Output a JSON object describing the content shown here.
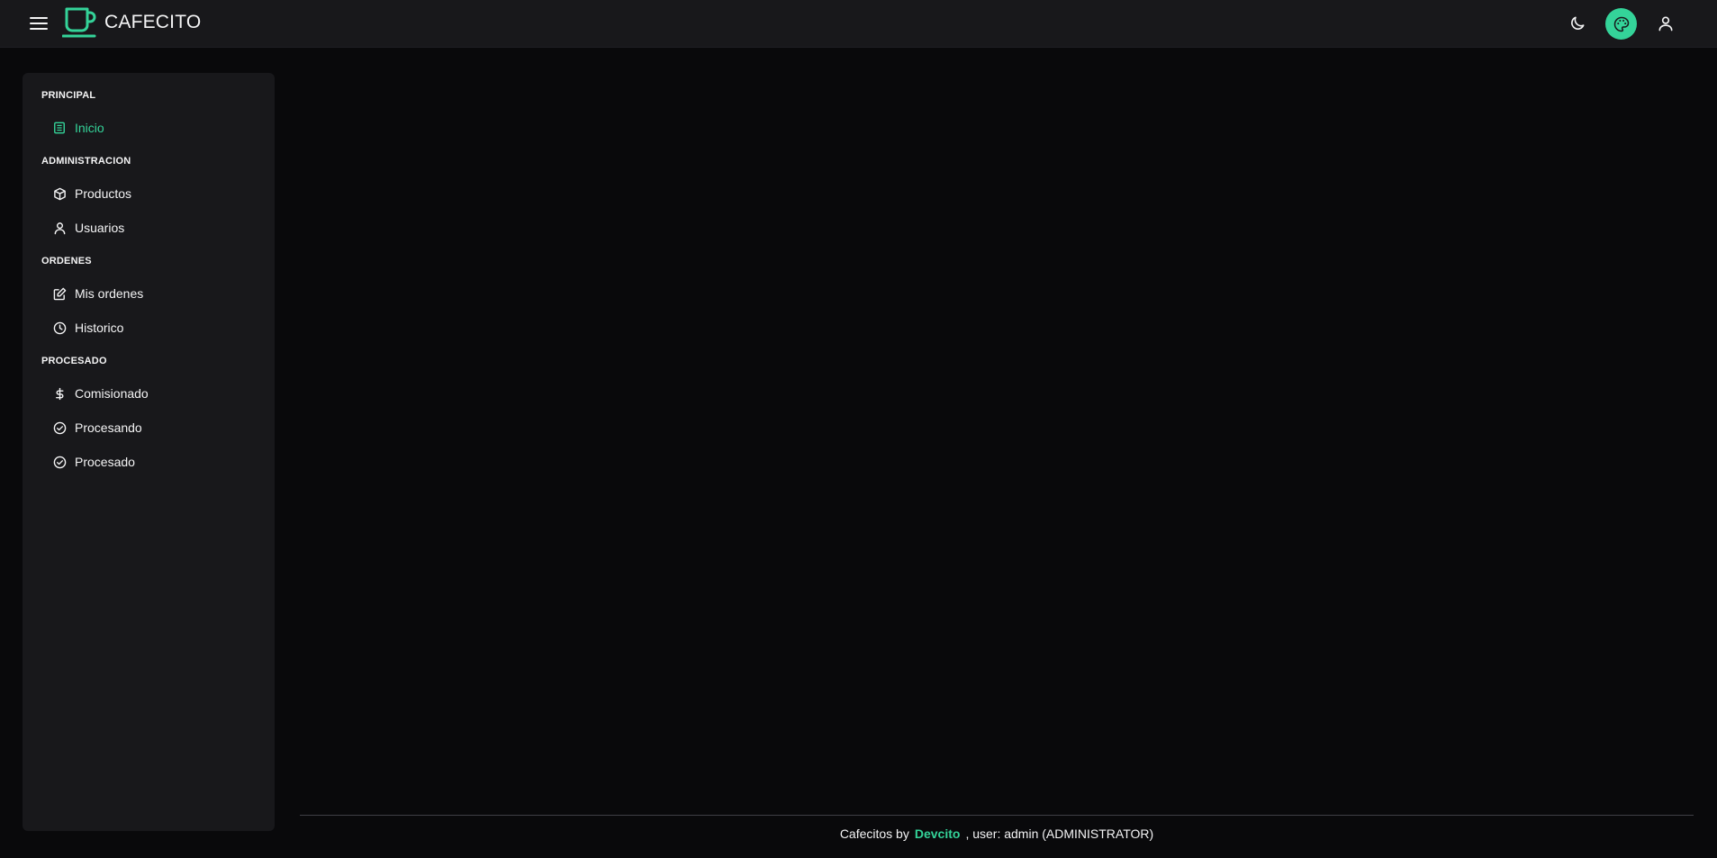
{
  "app": {
    "brand": "CAFECITO"
  },
  "topbar": {
    "menu_icon": "menu-icon",
    "theme_icon": "moon-icon",
    "palette_icon": "palette-icon",
    "user_icon": "user-icon"
  },
  "sidebar": {
    "sections": [
      {
        "title": "PRINCIPAL",
        "items": [
          {
            "label": "Inicio",
            "icon": "list-icon",
            "active": true
          }
        ]
      },
      {
        "title": "ADMINISTRACION",
        "items": [
          {
            "label": "Productos",
            "icon": "box-icon"
          },
          {
            "label": "Usuarios",
            "icon": "user-icon"
          }
        ]
      },
      {
        "title": "ORDENES",
        "items": [
          {
            "label": "Mis ordenes",
            "icon": "edit-icon"
          },
          {
            "label": "Historico",
            "icon": "clock-icon"
          }
        ]
      },
      {
        "title": "PROCESADO",
        "items": [
          {
            "label": "Comisionado",
            "icon": "dollar-icon"
          },
          {
            "label": "Procesando",
            "icon": "check-circle-icon"
          },
          {
            "label": "Procesado",
            "icon": "check-circle-icon"
          }
        ]
      }
    ]
  },
  "footer": {
    "prefix": "Cafecitos by",
    "link": "Devcito",
    "suffix": ", user: admin (ADMINISTRATOR)"
  },
  "colors": {
    "accent": "#34d399",
    "background": "#09090b",
    "panel": "#18181b"
  }
}
